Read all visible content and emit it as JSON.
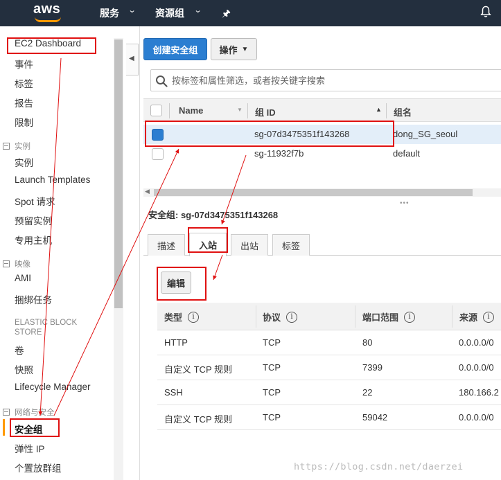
{
  "topnav": {
    "logo": "aws",
    "services": "服务",
    "resource_groups": "资源组",
    "pin_icon": "pin-icon",
    "bell_icon": "bell-icon"
  },
  "sidebar": {
    "dashboard": "EC2 Dashboard",
    "events": "事件",
    "tags": "标签",
    "reports": "报告",
    "limits": "限制",
    "group_instances": "实例",
    "instances": "实例",
    "launch_templates": "Launch Templates",
    "spot": "Spot 请求",
    "reserved": "预留实例",
    "dedicated_hosts": "专用主机",
    "group_images": "映像",
    "ami": "AMI",
    "bundle_tasks": "捆绑任务",
    "group_ebs": "ELASTIC BLOCK STORE",
    "volumes": "卷",
    "snapshots": "快照",
    "lifecycle": "Lifecycle Manager",
    "group_network": "网络与安全",
    "security_groups": "安全组",
    "elastic_ip": "弹性 IP",
    "placement_groups": "个置放群组"
  },
  "toolbar": {
    "create_label": "创建安全组",
    "actions_label": "操作"
  },
  "search": {
    "placeholder": "按标签和属性筛选，或者按关键字搜索"
  },
  "table": {
    "headers": {
      "name": "Name",
      "group_id": "组 ID",
      "group_name": "组名"
    },
    "rows": [
      {
        "name": "",
        "group_id": "sg-07d3475351f143268",
        "group_name": "dong_SG_seoul",
        "selected": true
      },
      {
        "name": "",
        "group_id": "sg-11932f7b",
        "group_name": "default",
        "selected": false
      }
    ]
  },
  "detail": {
    "title": "安全组: sg-07d3475351f143268",
    "tabs": [
      "描述",
      "入站",
      "出站",
      "标签"
    ],
    "active_tab": "入站",
    "edit_label": "编辑",
    "rule_headers": {
      "type": "类型",
      "protocol": "协议",
      "port_range": "端口范围",
      "source": "来源"
    },
    "rules": [
      {
        "type": "HTTP",
        "protocol": "TCP",
        "port": "80",
        "source": "0.0.0.0/0"
      },
      {
        "type": "自定义 TCP 规则",
        "protocol": "TCP",
        "port": "7399",
        "source": "0.0.0.0/0"
      },
      {
        "type": "SSH",
        "protocol": "TCP",
        "port": "22",
        "source": "180.166.2"
      },
      {
        "type": "自定义 TCP 规则",
        "protocol": "TCP",
        "port": "59042",
        "source": "0.0.0.0/0"
      }
    ]
  },
  "watermark": "https://blog.csdn.net/daerzei",
  "colors": {
    "nav_bg": "#232f3e",
    "accent_orange": "#ff9900",
    "primary_blue": "#2b7ed1",
    "annotation_red": "#e01010"
  }
}
